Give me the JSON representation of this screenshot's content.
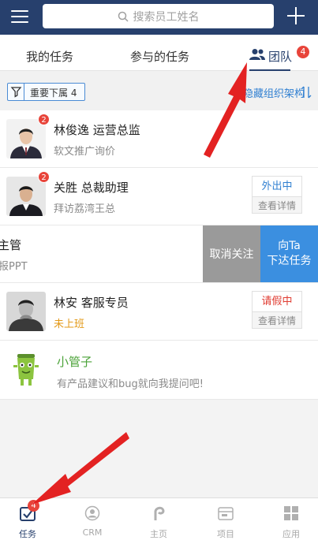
{
  "topbar": {
    "search_placeholder": "搜索员工姓名",
    "menu_icon": "hamburger-icon",
    "add_icon": "plus-icon"
  },
  "tabs": {
    "my_tasks": "我的任务",
    "joined_tasks": "参与的任务",
    "team": "团队",
    "team_badge": "4"
  },
  "filter": {
    "chip_label": "重要下属 4",
    "hide_org": "隐藏组织架构"
  },
  "members": [
    {
      "name": "林俊逸 运营总监",
      "sub": "软文推广询价",
      "badge": "2"
    },
    {
      "name": "关胜 总裁助理",
      "sub": "拜访荔湾王总",
      "badge": "2",
      "status": "外出中",
      "details": "查看详情"
    },
    {
      "name": "主管",
      "sub": "报PPT",
      "action_unfollow": "取消关注",
      "action_assign_1": "向Ta",
      "action_assign_2": "下达任务"
    },
    {
      "name": "林安 客服专员",
      "sub": "未上班",
      "status": "请假中",
      "details": "查看详情"
    },
    {
      "name": "小管子",
      "sub": "有产品建议和bug就向我提问吧!"
    }
  ],
  "bottom_nav": {
    "tasks": "任务",
    "tasks_badge": "4",
    "crm": "CRM",
    "home": "主页",
    "project": "项目",
    "apps": "应用"
  },
  "colors": {
    "navy": "#27406d",
    "badge_red": "#e8443a",
    "status_blue": "#2f7fd1",
    "status_red": "#e03c32",
    "orange": "#e39a1a",
    "green": "#4ca33a",
    "arrow_red": "#e32222"
  }
}
